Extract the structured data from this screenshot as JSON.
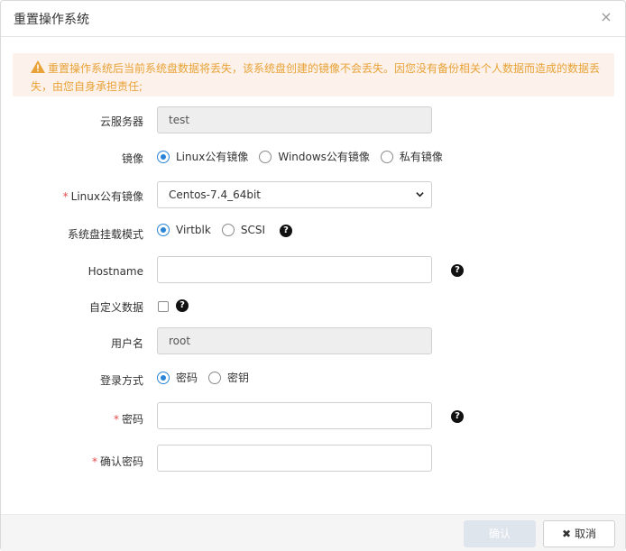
{
  "dialog": {
    "title": "重置操作系统"
  },
  "alert": {
    "message": "重置操作系统后当前系统盘数据将丢失，该系统盘创建的镜像不会丢失。因您没有备份相关个人数据而造成的数据丢失，由您自身承担责任;"
  },
  "form": {
    "server": {
      "label": "云服务器",
      "value": "test"
    },
    "image": {
      "label": "镜像",
      "options": [
        "Linux公有镜像",
        "Windows公有镜像",
        "私有镜像"
      ],
      "selected": "Linux公有镜像"
    },
    "linux_image": {
      "label": "Linux公有镜像",
      "value": "Centos-7.4_64bit"
    },
    "disk_mode": {
      "label": "系统盘挂载模式",
      "options": [
        "Virtblk",
        "SCSI"
      ],
      "selected": "Virtblk"
    },
    "hostname": {
      "label": "Hostname",
      "value": ""
    },
    "custom_data": {
      "label": "自定义数据",
      "checked": false
    },
    "username": {
      "label": "用户名",
      "value": "root"
    },
    "login": {
      "label": "登录方式",
      "options": [
        "密码",
        "密钥"
      ],
      "selected": "密码"
    },
    "password": {
      "label": "密码",
      "value": ""
    },
    "confirm_password": {
      "label": "确认密码",
      "value": ""
    }
  },
  "footer": {
    "confirm_label": "确认",
    "cancel_label": "取消"
  },
  "colors": {
    "accent": "#2a84d6",
    "warning": "#e8a237",
    "required": "#e84a4a"
  }
}
